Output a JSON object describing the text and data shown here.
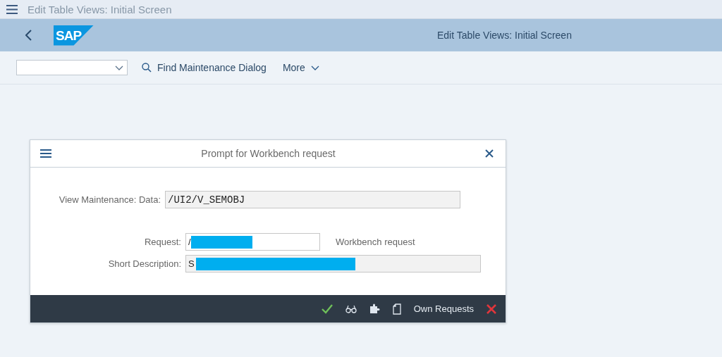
{
  "shell": {
    "title": "Edit Table Views: Initial Screen"
  },
  "header": {
    "title": "Edit Table Views: Initial Screen",
    "logo": "SAP"
  },
  "toolbar": {
    "find_button": "Find Maintenance Dialog",
    "more_button": "More"
  },
  "dialog": {
    "title": "Prompt for Workbench request",
    "view_field": {
      "label": "View Maintenance: Data:",
      "value": "/UI2/V_SEMOBJ"
    },
    "request_field": {
      "label": "Request:",
      "value": "/",
      "redacted": true,
      "hint": "Workbench request"
    },
    "description_field": {
      "label": "Short Description:",
      "value": "S",
      "redacted": true
    },
    "footer_buttons": [
      {
        "kind": "check"
      },
      {
        "kind": "glasses"
      },
      {
        "kind": "puzzle"
      },
      {
        "kind": "page"
      },
      {
        "kind": "text",
        "label": "Own Requests"
      },
      {
        "kind": "cancel"
      }
    ]
  }
}
